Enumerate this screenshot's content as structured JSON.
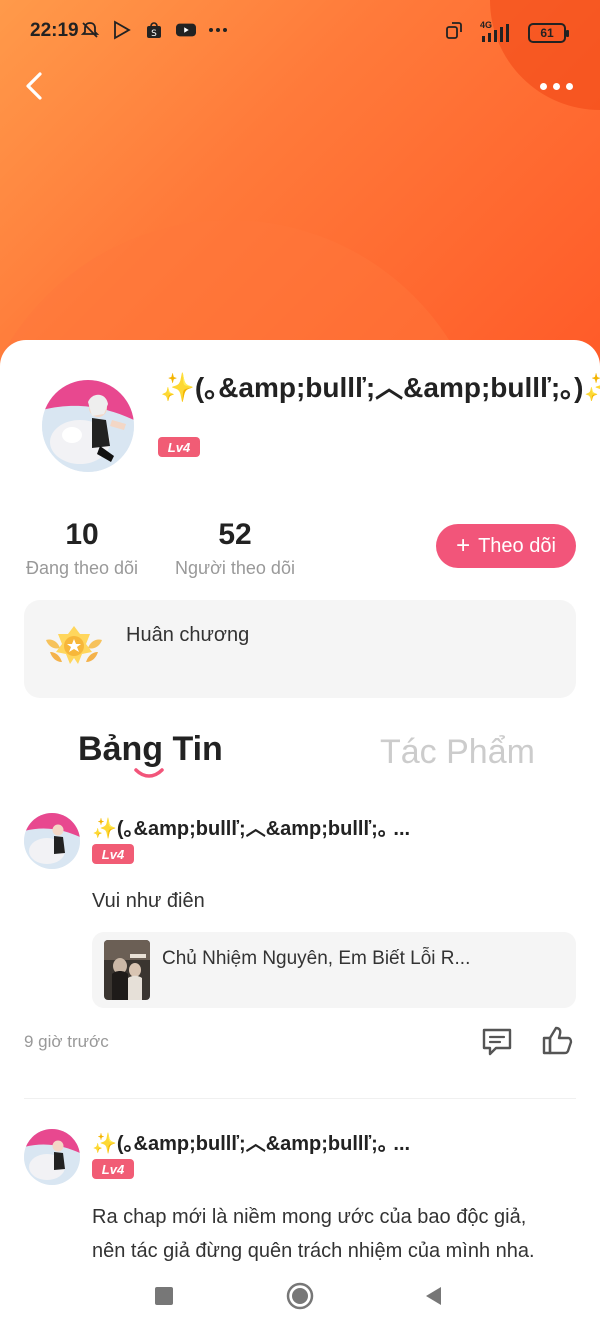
{
  "status_bar": {
    "time": "22:19",
    "battery": "61",
    "icons": [
      "bell-off-icon",
      "play-store-icon",
      "shopee-icon",
      "youtube-icon",
      "more-dots-icon"
    ],
    "right_icons": [
      "screen-rotate-icon",
      "4g-signal-icon",
      "battery-icon"
    ],
    "network_label": "4G"
  },
  "profile": {
    "username": "✨(｡&amp;bullľ;︿&amp;bullľ;｡)✨",
    "level": "Lv4",
    "following_count": "10",
    "following_label": "Đang theo dõi",
    "followers_count": "52",
    "followers_label": "Người theo dõi",
    "follow_button": "Theo dõi"
  },
  "medal": {
    "title": "Huân chương"
  },
  "tabs": [
    {
      "label": "Bảng Tin",
      "active": true
    },
    {
      "label": "Tác Phẩm",
      "active": false
    }
  ],
  "posts": [
    {
      "author": "✨(｡&amp;bullľ;︿&amp;bullľ;｡ ...",
      "level": "Lv4",
      "text": "Vui như điên",
      "book_title": "Chủ Nhiệm Nguyên, Em Biết Lỗi R...",
      "time": "9 giờ trước"
    },
    {
      "author": "✨(｡&amp;bullľ;︿&amp;bullľ;｡ ...",
      "level": "Lv4",
      "text_line1": "Ra chap mới là niềm mong ước của bao độc giả,",
      "text_line2": "nên tác giả đừng quên trách nhiệm của mình nha."
    }
  ],
  "colors": {
    "header_gradient_start": "#ff9a4a",
    "header_gradient_end": "#ff5a28",
    "accent_pink": "#f2557a",
    "badge_pink": "#f15c75"
  }
}
